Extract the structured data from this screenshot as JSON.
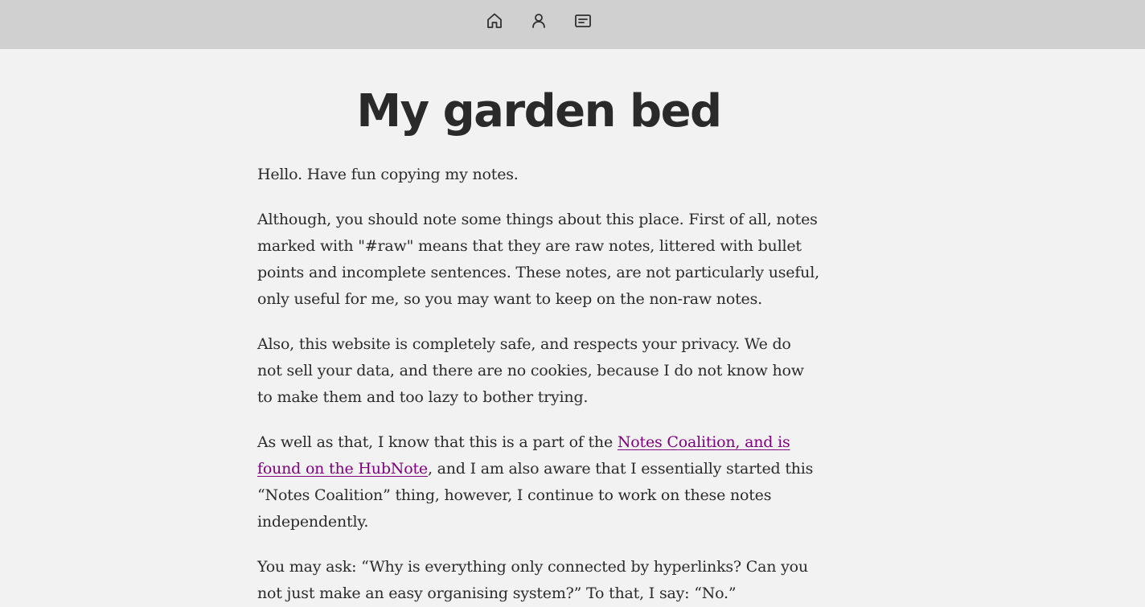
{
  "nav": {
    "items": [
      {
        "icon": "home-icon",
        "label": "Home"
      },
      {
        "icon": "user-icon",
        "label": "About"
      },
      {
        "icon": "message-icon",
        "label": "Notes"
      }
    ]
  },
  "page": {
    "title": "My garden bed",
    "p1": "Hello. Have fun copying my notes.",
    "p2": "Although, you should note some things about this place. First of all, notes marked with \"#raw\" means that they are raw notes, littered with bullet points and incomplete sentences. These notes, are not particularly useful, only useful for me, so you may want to keep on the non-raw notes.",
    "p3": "Also, this website is completely safe, and respects your privacy. We do not sell your data, and there are no cookies, because I do not know how to make them and too lazy to bother trying.",
    "p4_before": "As well as that, I know that this is a part of the ",
    "p4_link": "Notes Coalition, and is found on the HubNote",
    "p4_after": ", and I am also aware that I essentially started this “Notes Coalition” thing, however, I continue to work on these notes independently.",
    "p5": "You may ask: “Why is everything only connected by hyperlinks? Can you not just make an easy organising system?” To that, I say: “No.”"
  },
  "colors": {
    "topbar": "#d0d0d0",
    "background": "#f2f2f2",
    "link": "#800080",
    "text": "#2b2b2b"
  }
}
